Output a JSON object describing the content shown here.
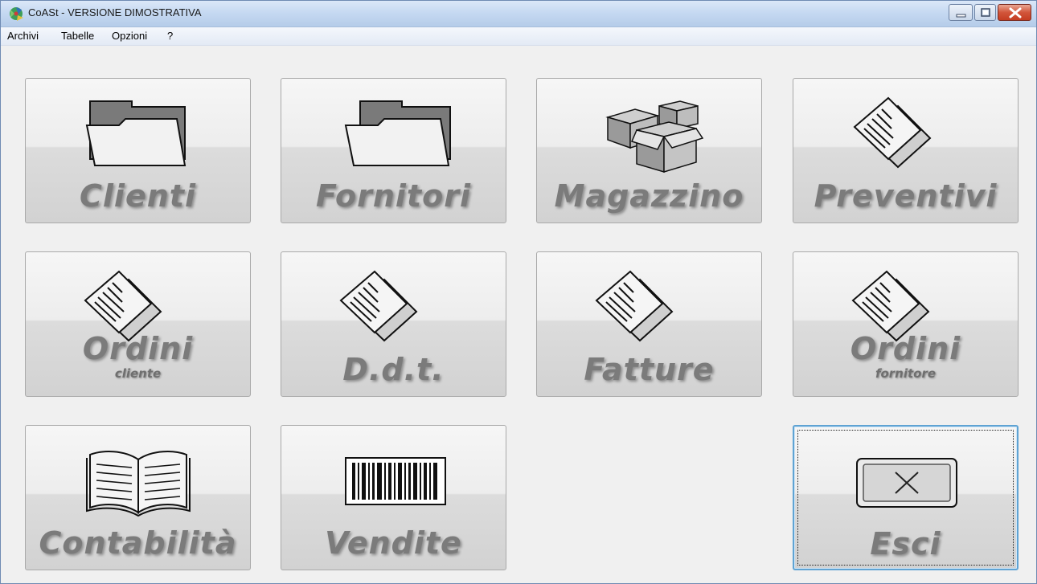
{
  "window": {
    "title": "CoASt - VERSIONE DIMOSTRATIVA",
    "app_icon": "coast-app-icon"
  },
  "menu": {
    "items": [
      {
        "label": "Archivi"
      },
      {
        "label": "Tabelle"
      },
      {
        "label": "Opzioni"
      },
      {
        "label": "?"
      }
    ]
  },
  "tiles": {
    "clienti": {
      "label": "Clienti",
      "icon": "folder-icon"
    },
    "fornitori": {
      "label": "Fornitori",
      "icon": "folder-icon"
    },
    "magazzino": {
      "label": "Magazzino",
      "icon": "boxes-icon"
    },
    "preventivi": {
      "label": "Preventivi",
      "icon": "documents-icon"
    },
    "ordini_cliente": {
      "label": "Ordini",
      "sub": "cliente",
      "icon": "documents-icon"
    },
    "ddt": {
      "label": "D.d.t.",
      "icon": "documents-icon"
    },
    "fatture": {
      "label": "Fatture",
      "icon": "documents-icon"
    },
    "ordini_fornitore": {
      "label": "Ordini",
      "sub": "fornitore",
      "icon": "documents-icon"
    },
    "contabilita": {
      "label": "Contabilità",
      "icon": "open-book-icon"
    },
    "vendite": {
      "label": "Vendite",
      "icon": "barcode-icon"
    },
    "esci": {
      "label": "Esci",
      "icon": "close-x-icon"
    }
  }
}
